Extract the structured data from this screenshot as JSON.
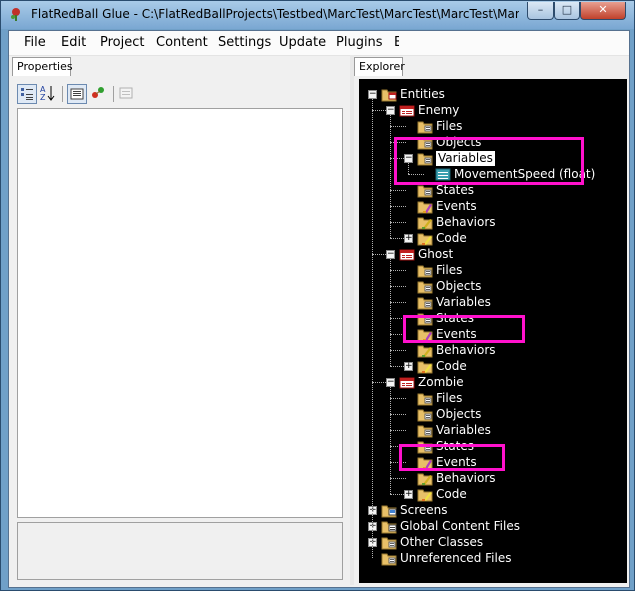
{
  "window": {
    "title": "FlatRedBall Glue - C:\\FlatRedBallProjects\\Testbed\\MarcTest\\MarcTest\\MarcTest\\MarcTest.c...",
    "controls": {
      "minimize": "–",
      "maximize": "□",
      "close": "✕"
    }
  },
  "menu": {
    "items": [
      "File",
      "Edit",
      "Project",
      "Content",
      "Settings",
      "Update",
      "Plugins",
      "E"
    ]
  },
  "properties": {
    "tab_label": "Properties",
    "toolbar_icons": [
      "categorized-icon",
      "alphabetical-sort-icon",
      "property-pages-icon",
      "events-icon",
      "disabled-page-icon"
    ]
  },
  "explorer": {
    "tab_label": "Explorer",
    "nodes": [
      {
        "label": "Entities",
        "icon": "folder-entities-icon"
      },
      {
        "label": "Enemy",
        "icon": "entity-icon"
      },
      {
        "label": "Files",
        "icon": "folder-icon"
      },
      {
        "label": "Objects",
        "icon": "folder-icon"
      },
      {
        "label": "Variables",
        "icon": "folder-icon"
      },
      {
        "label": "MovementSpeed (float)",
        "icon": "variable-icon"
      },
      {
        "label": "States",
        "icon": "folder-icon"
      },
      {
        "label": "Events",
        "icon": "events-icon"
      },
      {
        "label": "Behaviors",
        "icon": "behaviors-icon"
      },
      {
        "label": "Code",
        "icon": "code-icon"
      },
      {
        "label": "Ghost",
        "icon": "entity-icon"
      },
      {
        "label": "Files",
        "icon": "folder-icon"
      },
      {
        "label": "Objects",
        "icon": "folder-icon"
      },
      {
        "label": "Variables",
        "icon": "folder-icon"
      },
      {
        "label": "States",
        "icon": "folder-icon"
      },
      {
        "label": "Events",
        "icon": "events-icon"
      },
      {
        "label": "Behaviors",
        "icon": "behaviors-icon"
      },
      {
        "label": "Code",
        "icon": "code-icon"
      },
      {
        "label": "Zombie",
        "icon": "entity-icon"
      },
      {
        "label": "Files",
        "icon": "folder-icon"
      },
      {
        "label": "Objects",
        "icon": "folder-icon"
      },
      {
        "label": "Variables",
        "icon": "folder-icon"
      },
      {
        "label": "States",
        "icon": "folder-icon"
      },
      {
        "label": "Events",
        "icon": "events-icon"
      },
      {
        "label": "Behaviors",
        "icon": "behaviors-icon"
      },
      {
        "label": "Code",
        "icon": "code-icon"
      },
      {
        "label": "Screens",
        "icon": "folder-screens-icon"
      },
      {
        "label": "Global Content Files",
        "icon": "folder-global-icon"
      },
      {
        "label": "Other Classes",
        "icon": "folder-icon"
      },
      {
        "label": "Unreferenced Files",
        "icon": "folder-icon"
      }
    ]
  },
  "colors": {
    "tree_background": "#000000",
    "tree_text": "#ffffff",
    "highlight_box": "#ff11cc",
    "folder": "#e8c068"
  }
}
